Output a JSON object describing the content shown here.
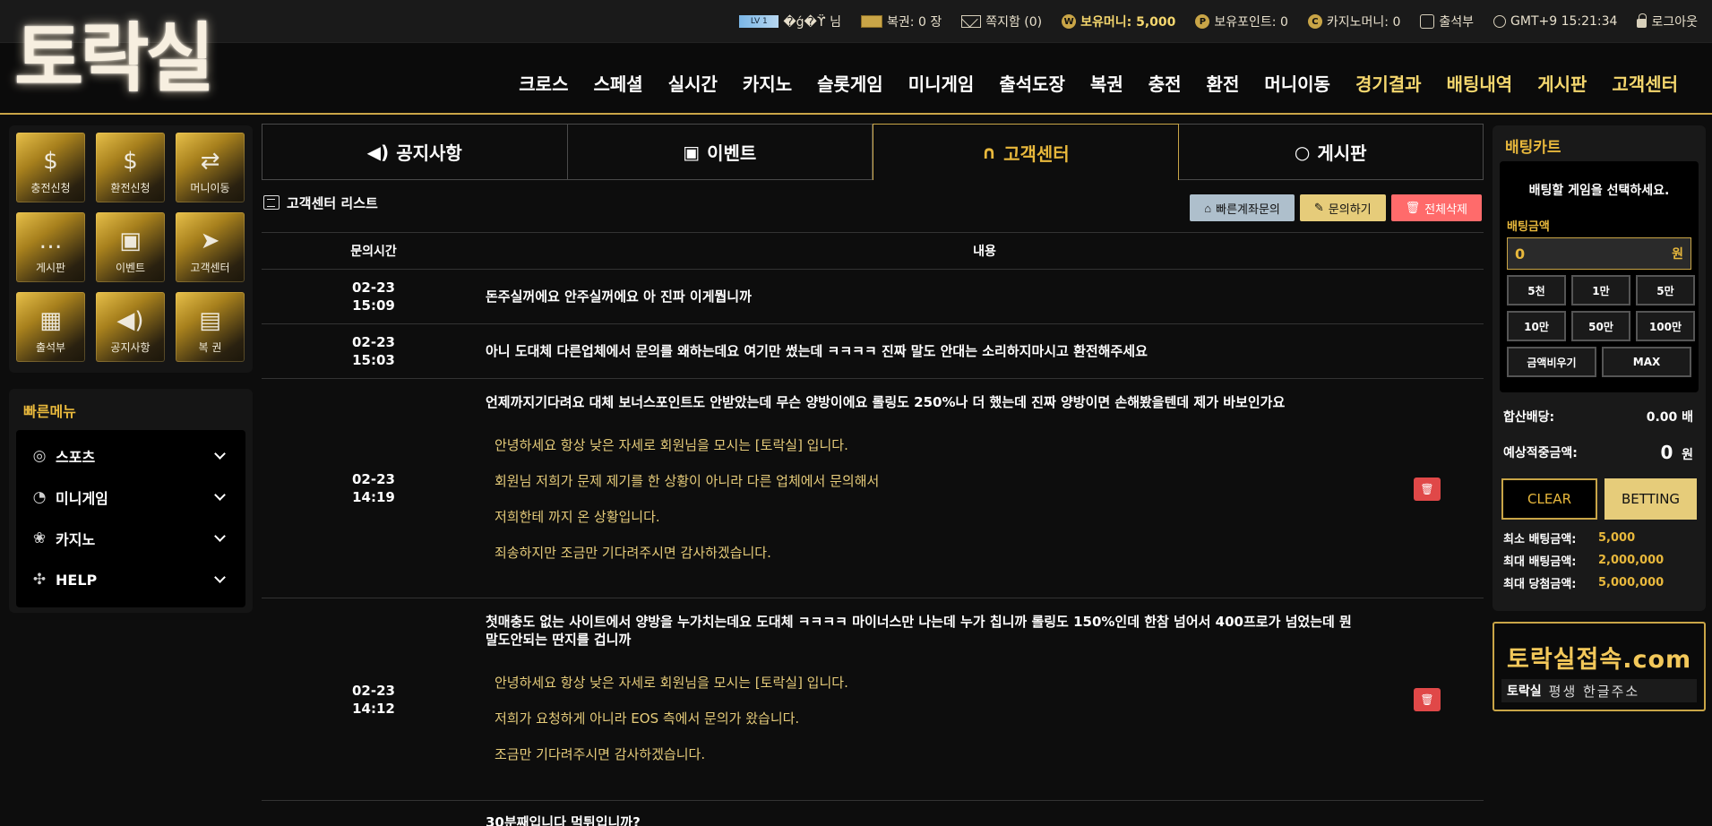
{
  "header": {
    "logo_text": "토락실",
    "topbar": {
      "level_badge": "LV 1",
      "user_name": "�ǵ�ϔ 님",
      "lottery": "복권: 0 장",
      "messages": "쪽지함 (0)",
      "money": "보유머니: 5,000",
      "points": "보유포인트: 0",
      "casino_money": "카지노머니: 0",
      "attendance": "출석부",
      "clock": "GMT+9 15:21:34",
      "logout": "로그아웃"
    },
    "nav": [
      {
        "label": "크로스"
      },
      {
        "label": "스페셜"
      },
      {
        "label": "실시간"
      },
      {
        "label": "카지노"
      },
      {
        "label": "슬롯게임"
      },
      {
        "label": "미니게임"
      },
      {
        "label": "출석도장"
      },
      {
        "label": "복권"
      },
      {
        "label": "충전"
      },
      {
        "label": "환전"
      },
      {
        "label": "머니이동"
      },
      {
        "label": "경기결과"
      },
      {
        "label": "배팅내역"
      },
      {
        "label": "게시판"
      },
      {
        "label": "고객센터"
      }
    ]
  },
  "sidebar": {
    "quick_buttons": [
      {
        "label": "충전신청"
      },
      {
        "label": "환전신청"
      },
      {
        "label": "머니이동"
      },
      {
        "label": "게시판"
      },
      {
        "label": "이벤트"
      },
      {
        "label": "고객센터"
      },
      {
        "label": "출석부"
      },
      {
        "label": "공지사항"
      },
      {
        "label": "복 권"
      }
    ],
    "quick_menu_title": "빠른메뉴",
    "quick_menu": [
      {
        "label": "스포츠"
      },
      {
        "label": "미니게임"
      },
      {
        "label": "카지노"
      },
      {
        "label": "HELP"
      }
    ]
  },
  "main": {
    "tabs": [
      {
        "label": "공지사항"
      },
      {
        "label": "이벤트"
      },
      {
        "label": "고객센터"
      },
      {
        "label": "게시판"
      }
    ],
    "list_title": "고객센터 리스트",
    "buttons": {
      "quick_account": "빠른계좌문의",
      "inquire": "문의하기",
      "delete_all": "전체삭제"
    },
    "columns": {
      "time": "문의시간",
      "content": "내용"
    },
    "rows": [
      {
        "date": "02-23",
        "time": "15:09",
        "question": "돈주실꺼에요 안주실꺼에요 아 진파 이게뭡니까",
        "answers": []
      },
      {
        "date": "02-23",
        "time": "15:03",
        "question": "아니 도대체 다른업체에서 문의를 왜하는데요 여기만 썼는데 ㅋㅋㅋㅋ 진짜 말도 안대는 소리하지마시고 환전해주세요",
        "answers": []
      },
      {
        "date": "02-23",
        "time": "14:19",
        "question": "언제까지기다려요 대체 보너스포인트도 안받았는데 무슨 양방이에요 롤링도 250%나 더 했는데 진짜 양방이면 손해봤을텐데 제가 바보인가요",
        "answers": [
          "안녕하세요 항상 낮은 자세로 회원님을 모시는 [토락실] 입니다.",
          "회원님 저희가 문제 제기를 한 상황이 아니라 다른 업체에서 문의해서",
          "저희한테 까지 온 상황입니다.",
          "죄송하지만 조금만 기다려주시면 감사하겠습니다."
        ]
      },
      {
        "date": "02-23",
        "time": "14:12",
        "question": "첫매충도 없는 사이트에서 양방을 누가치는데요 도대체 ㅋㅋㅋㅋ 마이너스만 나는데 누가 칩니까 롤링도 150%인데 한참 넘어서 400프로가 넘었는데 뭔 말도안되는 딴지를 겁니까",
        "answers": [
          "안녕하세요 항상 낮은 자세로 회원님을 모시는 [토락실] 입니다.",
          "저희가 요청하게 아니라 EOS 측에서 문의가 왔습니다.",
          "조금만 기다려주시면 감사하겠습니다."
        ]
      },
      {
        "date": "",
        "time": "",
        "question": "30분째입니다 먹튀입니까?",
        "answers": []
      }
    ],
    "delete_label": "🗑"
  },
  "betcart": {
    "title": "배팅카트",
    "message": "배팅할 게임을 선택하세요.",
    "amount_label": "배팅금액",
    "amount_value": "0",
    "amount_unit": "원",
    "amounts": [
      "5천",
      "1만",
      "5만",
      "10만",
      "50만",
      "100만"
    ],
    "reset": "금액비우기",
    "max": "MAX",
    "combined_odds_label": "합산배당:",
    "combined_odds_value": "0.00 배",
    "expected_label": "예상적중금액:",
    "expected_value": "0",
    "expected_unit": "원",
    "clear": "CLEAR",
    "betting": "BETTING",
    "limits": [
      {
        "label": "최소 배팅금액:",
        "value": "5,000"
      },
      {
        "label": "최대 배팅금액:",
        "value": "2,000,000"
      },
      {
        "label": "최대 당첨금액:",
        "value": "5,000,000"
      }
    ]
  },
  "banner": {
    "main": "토락실접속",
    "domain": ".com",
    "sub_logo": "토락실",
    "sub_text": "평생 한글주소"
  }
}
